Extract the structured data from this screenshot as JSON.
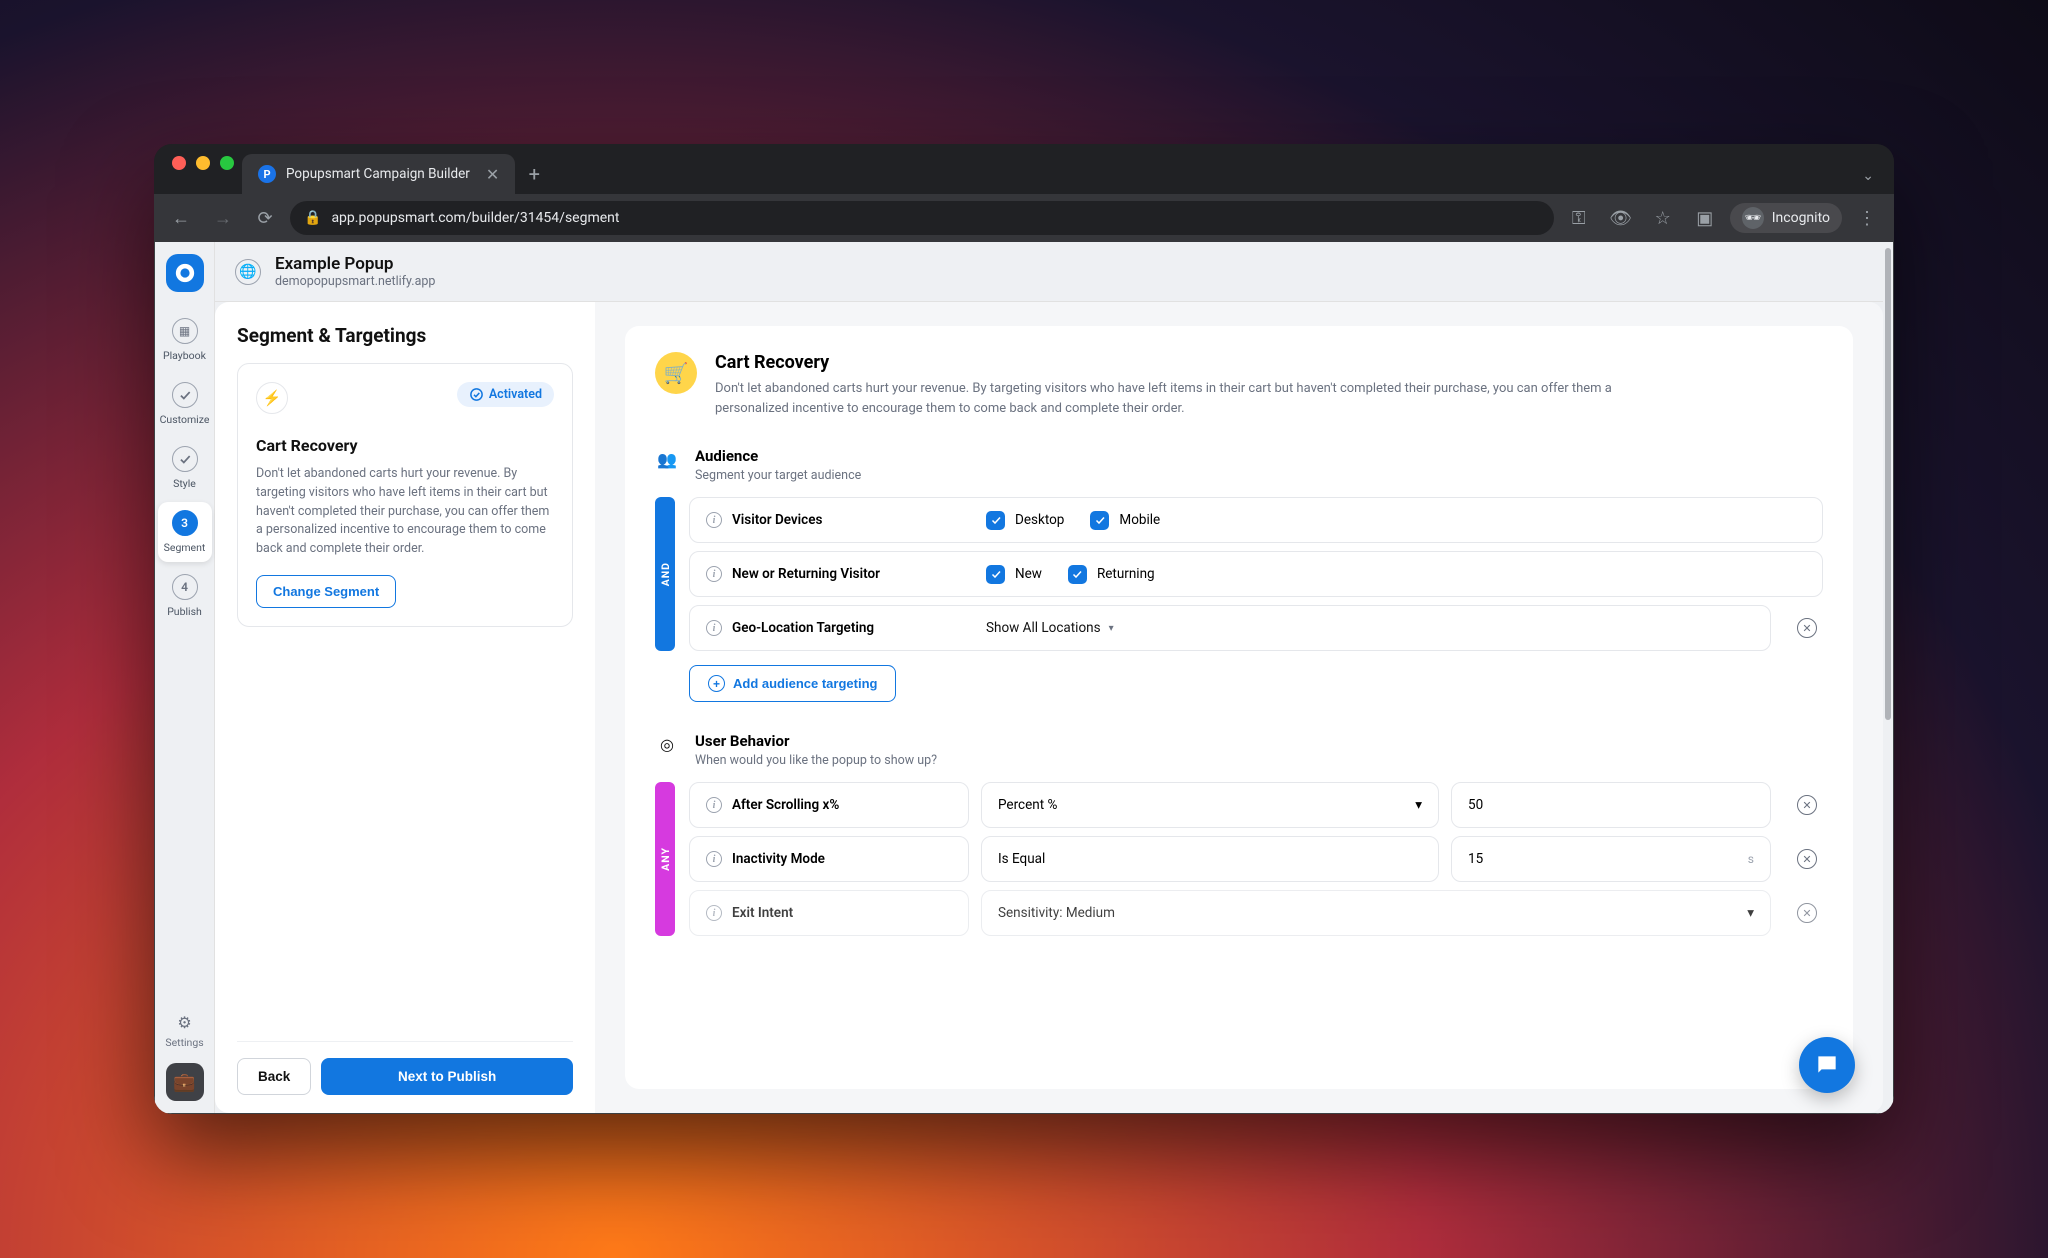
{
  "browser": {
    "tab_title": "Popupsmart Campaign Builder",
    "url": "app.popupsmart.com/builder/31454/segment",
    "incognito_label": "Incognito"
  },
  "header": {
    "title": "Example Popup",
    "domain": "demopopupsmart.netlify.app"
  },
  "rail": {
    "steps": [
      {
        "label": "Playbook"
      },
      {
        "label": "Customize"
      },
      {
        "label": "Style"
      },
      {
        "label": "Segment",
        "num": "3",
        "active": true
      },
      {
        "label": "Publish",
        "num": "4"
      }
    ],
    "settings": "Settings"
  },
  "side": {
    "title": "Segment & Targetings",
    "status": "Activated",
    "card_title": "Cart Recovery",
    "card_body": "Don't let abandoned carts hurt your revenue. By targeting visitors who have left items in their cart but haven't completed their purchase, you can offer them a personalized incentive to encourage them to come back and complete their order.",
    "change_btn": "Change Segment",
    "back": "Back",
    "next": "Next to Publish"
  },
  "main": {
    "hero_title": "Cart Recovery",
    "hero_body": "Don't let abandoned carts hurt your revenue. By targeting visitors who have left items in their cart but haven't completed their purchase, you can offer them a personalized incentive to encourage them to come back and complete their order.",
    "audience": {
      "title": "Audience",
      "sub": "Segment your target audience",
      "tag": "AND",
      "rows": {
        "devices_label": "Visitor Devices",
        "desktop": "Desktop",
        "mobile": "Mobile",
        "newret_label": "New or Returning Visitor",
        "new": "New",
        "returning": "Returning",
        "geo_label": "Geo-Location Targeting",
        "geo_value": "Show All Locations"
      },
      "add_btn": "Add audience targeting"
    },
    "behavior": {
      "title": "User Behavior",
      "sub": "When would you like the popup to show up?",
      "tag": "ANY",
      "scroll_label": "After Scrolling x%",
      "scroll_mode": "Percent %",
      "scroll_value": "50",
      "inactivity_label": "Inactivity Mode",
      "inactivity_mode": "Is Equal",
      "inactivity_value": "15",
      "inactivity_unit": "s",
      "exit_label": "Exit Intent",
      "exit_mode": "Sensitivity: Medium"
    }
  }
}
